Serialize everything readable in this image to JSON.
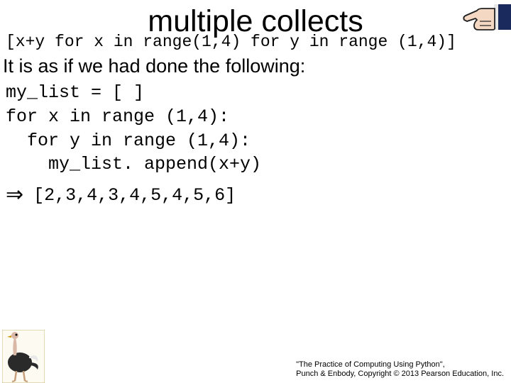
{
  "title": "multiple collects",
  "code_line1": "[x+y for x in range(1,4) for y in range (1,4)]",
  "intro": "It is as if we had done the following:",
  "code_block": "my_list = [ ]\nfor x in range (1,4):\n  for y in range (1,4):\n    my_list. append(x+y)",
  "arrow": "⇒",
  "result": "[2,3,4,3,4,5,4,5,6]",
  "footer_line1": "\"The Practice of Computing Using Python\",",
  "footer_line2": "Punch & Enbody, Copyright © 2013 Pearson Education, Inc."
}
